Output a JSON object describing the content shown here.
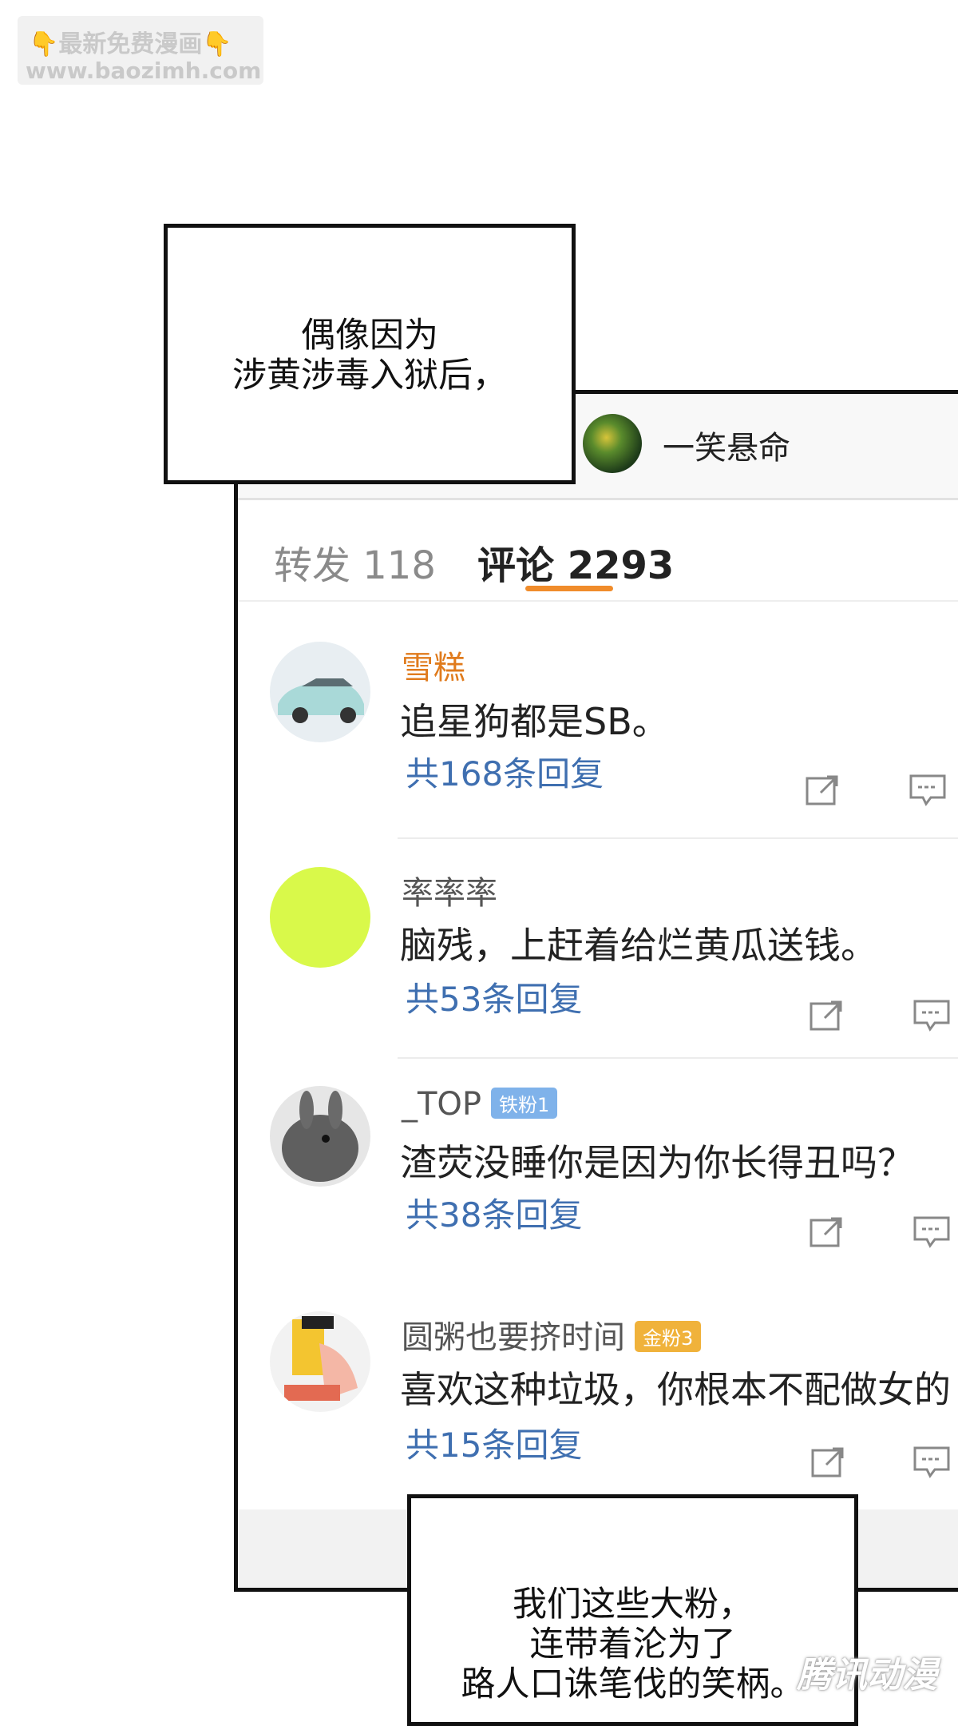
{
  "watermark": {
    "line1": "最新免费漫画",
    "hand_left": "👇",
    "hand_right": "👇",
    "url": "www.baozimh.com"
  },
  "caption_top": [
    "偶像因为",
    "涉黄涉毒入狱后，"
  ],
  "post": {
    "username": "一笑悬命"
  },
  "tabs": {
    "repost": "转发 118",
    "comments": "评论 2293",
    "active_color": "#f08c2b"
  },
  "comments": [
    {
      "name": "雪糕",
      "name_color": "#e07b1d",
      "badge": "",
      "text": "追星狗都是SB。",
      "replies": "共168条回复"
    },
    {
      "name": "率率率",
      "name_color": "#555555",
      "badge": "",
      "text": "脑残，上赶着给烂黄瓜送钱。",
      "replies": "共53条回复"
    },
    {
      "name": "_TOP",
      "name_color": "#555555",
      "badge": "铁粉1",
      "text": "渣荧没睡你是因为你长得丑吗？",
      "replies": "共38条回复"
    },
    {
      "name": "圆粥也要挤时间",
      "name_color": "#555555",
      "badge": "金粉3",
      "text": "喜欢这种垃圾，你根本不配做女的",
      "replies": "共15条回复"
    }
  ],
  "caption_bottom": [
    "我们这些大粉，",
    "连带着沦为了",
    "路人口诛笔伐的笑柄。"
  ],
  "watermark_bottom": "腾讯动漫",
  "icons": [
    "share-icon",
    "comment-icon"
  ]
}
